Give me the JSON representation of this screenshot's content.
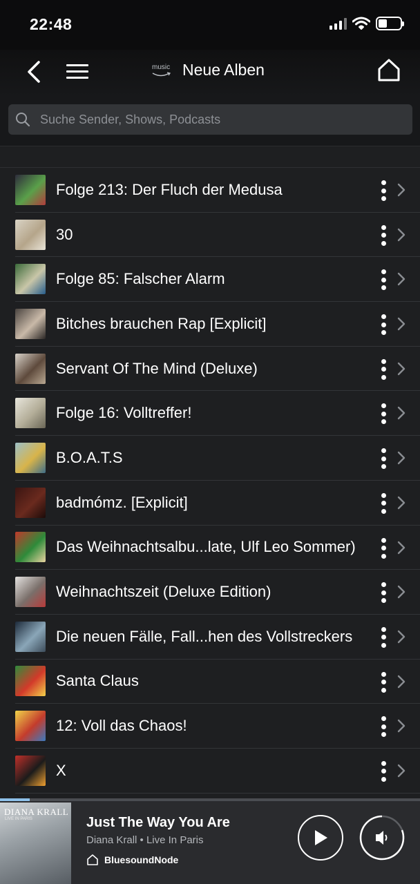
{
  "status": {
    "time": "22:48"
  },
  "header": {
    "logo_text": "music",
    "title": "Neue Alben"
  },
  "search": {
    "placeholder": "Suche Sender, Shows, Podcasts"
  },
  "albums": [
    {
      "title": "Folge 213: Der Fluch der Medusa",
      "colors": [
        "#2e2c3c",
        "#5aa04a",
        "#b23c3c"
      ]
    },
    {
      "title": "30",
      "colors": [
        "#d9d3c5",
        "#b5a58a",
        "#e9e4d8"
      ]
    },
    {
      "title": "Folge 85: Falscher Alarm",
      "colors": [
        "#3b6a3a",
        "#c9c6a8",
        "#275d8c"
      ]
    },
    {
      "title": "Bitches brauchen Rap [Explicit]",
      "colors": [
        "#4a4440",
        "#c9b9a8",
        "#2a2624"
      ]
    },
    {
      "title": "Servant Of The Mind (Deluxe)",
      "colors": [
        "#d8d2c9",
        "#5e4a3c",
        "#b9a892"
      ]
    },
    {
      "title": "Folge 16: Volltreffer!",
      "colors": [
        "#e8e6dc",
        "#b3ad98",
        "#6a6656"
      ]
    },
    {
      "title": "B.O.A.T.S",
      "colors": [
        "#9cc0c8",
        "#d8b44a",
        "#3f6e88"
      ]
    },
    {
      "title": "badmómz. [Explicit]",
      "colors": [
        "#3a1512",
        "#6a2a1e",
        "#1c0b09"
      ]
    },
    {
      "title": "Das Weihnachtsalbu...late, Ulf Leo Sommer)",
      "colors": [
        "#c0392b",
        "#2e8b3a",
        "#e9d3a0"
      ]
    },
    {
      "title": "Weihnachtszeit (Deluxe Edition)",
      "colors": [
        "#e4e2e0",
        "#7a6f6a",
        "#b83a3a"
      ]
    },
    {
      "title": "Die neuen Fälle, Fall...hen des Vollstreckers",
      "colors": [
        "#1d2a3a",
        "#8aa6b8",
        "#3c4c5a"
      ]
    },
    {
      "title": "Santa Claus",
      "colors": [
        "#2f8b3c",
        "#d23a2a",
        "#f2d04a"
      ]
    },
    {
      "title": "12: Voll das Chaos!",
      "colors": [
        "#f0d44a",
        "#c43c2c",
        "#3a7ac0"
      ]
    },
    {
      "title": "X",
      "colors": [
        "#c0302a",
        "#1b1b1b",
        "#f0a030"
      ]
    }
  ],
  "now_playing": {
    "cover_artist": "DIANA KRALL",
    "cover_album": "LIVE IN PARIS",
    "title": "Just The Way You Are",
    "subtitle": "Diana Krall • Live In Paris",
    "device": "BluesoundNode",
    "progress": 0.07
  },
  "colors": {
    "background": "#1e1f21",
    "accent": "#8ec1ea"
  }
}
